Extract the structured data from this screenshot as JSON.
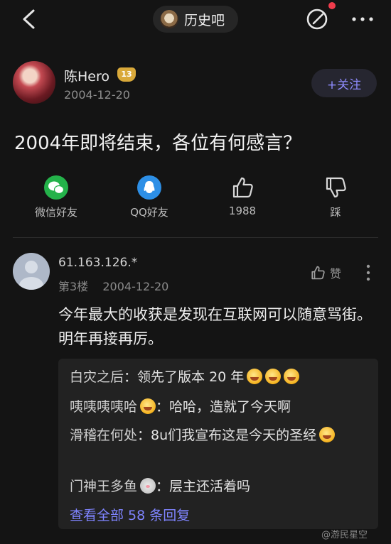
{
  "header": {
    "forum_name": "历史吧",
    "back_icon": "chevron-left-icon",
    "share_icon": "share-edit-icon",
    "more_icon": "ellipsis-icon",
    "notification_dot_color": "#ef3c4c"
  },
  "post": {
    "author": "陈Hero",
    "level": "13",
    "date": "2004-12-20",
    "follow_label": "+关注",
    "title": "2004年即将结束，各位有何感言？",
    "actions": [
      {
        "label": "微信好友",
        "icon": "wechat-icon",
        "color": "#24b24a"
      },
      {
        "label": "QQ好友",
        "icon": "qq-icon",
        "color": "#2d8fe6"
      },
      {
        "label": "1988",
        "icon": "thumbs-up-icon"
      },
      {
        "label": "踩",
        "icon": "thumbs-down-icon"
      }
    ]
  },
  "comment": {
    "user": "61.163.126.*",
    "floor": "第3楼",
    "date": "2004-12-20",
    "like_label": "赞",
    "text": "今年最大的收获是发现在互联网可以随意骂街。明年再接再厉。",
    "replies": [
      {
        "user": "白灾之后",
        "text": "领先了版本 20 年",
        "emojis": 3
      },
      {
        "user": "咦咦咦咦哈",
        "text": "哈哈，造就了今天啊",
        "emojis": 1
      },
      {
        "user": "滑稽在何处",
        "text": "8u们我宣布这是今天的圣经",
        "emojis": 1
      },
      {
        "user": "门神王多鱼",
        "text": "层主还活着吗",
        "emojis": 1
      }
    ],
    "view_all": "查看全部 58 条回复"
  },
  "watermark": "@游民星空"
}
